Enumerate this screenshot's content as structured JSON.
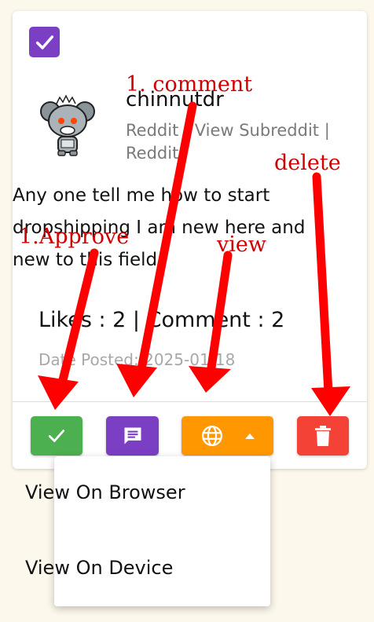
{
  "post": {
    "username": "chinnutdr",
    "subreddit": "Reddit | View Subreddit | Reddit",
    "text": "Any one tell me how to start dropshipping I am new here and new to this field",
    "stats": "Likes : 2 | Comment : 2",
    "date": "Date Posted: 2025-01-18"
  },
  "menu": {
    "items": [
      "View On Browser",
      "View On Device"
    ]
  },
  "annotations": {
    "comment": "1.  comment",
    "approve": "1.Approve",
    "view": "view",
    "delete": "delete"
  },
  "colors": {
    "approve": "#4caf50",
    "comment": "#7b3fc4",
    "view": "#ff9800",
    "delete": "#f44336",
    "arrow": "#ff0000",
    "annotation_text": "#d00000"
  },
  "icons": [
    "checkbox-checked-icon",
    "reddit-avatar-icon",
    "check-icon",
    "comment-icon",
    "globe-icon",
    "arrow-up-icon",
    "trash-icon"
  ]
}
